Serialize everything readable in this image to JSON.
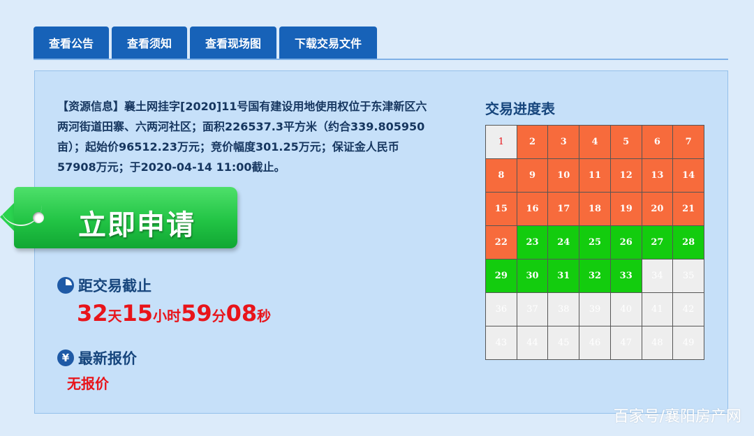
{
  "tabs": [
    "查看公告",
    "查看须知",
    "查看现场图",
    "下载交易文件"
  ],
  "resource_info": "【资源信息】襄土网挂字[2020]11号国有建设用地使用权位于东津新区六两河街道田寨、六两河社区；面积226537.3平方米（约合339.805950亩）；起始价96512.23万元；竞价幅度301.25万元；保证金人民币57908万元；于2020-04-14 11:00截止。",
  "apply_button": "立即申请",
  "deadline": {
    "heading": "距交易截止",
    "icon": "clock-icon",
    "days": "32",
    "days_unit": "天",
    "hours": "15",
    "hours_unit": "小时",
    "minutes": "59",
    "minutes_unit": "分",
    "seconds": "08",
    "seconds_unit": "秒"
  },
  "latest_price": {
    "heading": "最新报价",
    "icon": "yen-icon",
    "icon_glyph": "¥",
    "value": "无报价"
  },
  "progress": {
    "title": "交易进度表",
    "cells": [
      {
        "n": "1",
        "state": "current"
      },
      {
        "n": "2",
        "state": "orange"
      },
      {
        "n": "3",
        "state": "orange"
      },
      {
        "n": "4",
        "state": "orange"
      },
      {
        "n": "5",
        "state": "orange"
      },
      {
        "n": "6",
        "state": "orange"
      },
      {
        "n": "7",
        "state": "orange"
      },
      {
        "n": "8",
        "state": "orange"
      },
      {
        "n": "9",
        "state": "orange"
      },
      {
        "n": "10",
        "state": "orange"
      },
      {
        "n": "11",
        "state": "orange"
      },
      {
        "n": "12",
        "state": "orange"
      },
      {
        "n": "13",
        "state": "orange"
      },
      {
        "n": "14",
        "state": "orange"
      },
      {
        "n": "15",
        "state": "orange"
      },
      {
        "n": "16",
        "state": "orange"
      },
      {
        "n": "17",
        "state": "orange"
      },
      {
        "n": "18",
        "state": "orange"
      },
      {
        "n": "19",
        "state": "orange"
      },
      {
        "n": "20",
        "state": "orange"
      },
      {
        "n": "21",
        "state": "orange"
      },
      {
        "n": "22",
        "state": "orange"
      },
      {
        "n": "23",
        "state": "green"
      },
      {
        "n": "24",
        "state": "green"
      },
      {
        "n": "25",
        "state": "green"
      },
      {
        "n": "26",
        "state": "green"
      },
      {
        "n": "27",
        "state": "green"
      },
      {
        "n": "28",
        "state": "green"
      },
      {
        "n": "29",
        "state": "green"
      },
      {
        "n": "30",
        "state": "green"
      },
      {
        "n": "31",
        "state": "green"
      },
      {
        "n": "32",
        "state": "green"
      },
      {
        "n": "33",
        "state": "green"
      },
      {
        "n": "34",
        "state": "gray"
      },
      {
        "n": "35",
        "state": "gray"
      },
      {
        "n": "36",
        "state": "gray"
      },
      {
        "n": "37",
        "state": "gray"
      },
      {
        "n": "38",
        "state": "gray"
      },
      {
        "n": "39",
        "state": "gray"
      },
      {
        "n": "40",
        "state": "gray"
      },
      {
        "n": "41",
        "state": "gray"
      },
      {
        "n": "42",
        "state": "gray"
      },
      {
        "n": "43",
        "state": "gray"
      },
      {
        "n": "44",
        "state": "gray"
      },
      {
        "n": "45",
        "state": "gray"
      },
      {
        "n": "46",
        "state": "gray"
      },
      {
        "n": "47",
        "state": "gray"
      },
      {
        "n": "48",
        "state": "gray"
      },
      {
        "n": "49",
        "state": "gray"
      }
    ]
  },
  "watermark": "百家号/襄阳房产网",
  "colors": {
    "tab": "#1762b8",
    "panel": "#c6e0f9",
    "orange": "#f76b3c",
    "green": "#13cc0e",
    "red": "#e8141a"
  }
}
